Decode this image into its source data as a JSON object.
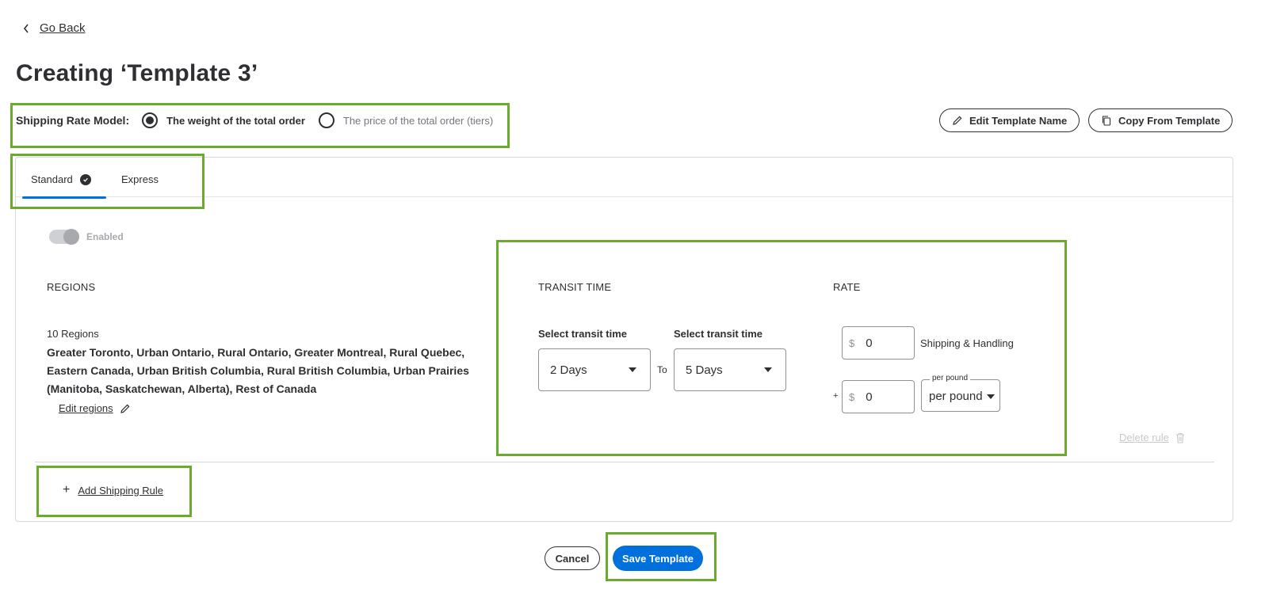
{
  "nav": {
    "go_back": "Go Back"
  },
  "page": {
    "title": "Creating ‘Template 3’"
  },
  "shipping_rate_model": {
    "label": "Shipping Rate Model:",
    "options": [
      {
        "label": "The weight of the total order",
        "selected": true
      },
      {
        "label": "The price of the total order (tiers)",
        "selected": false
      }
    ]
  },
  "actions": {
    "edit_template_name": "Edit Template Name",
    "copy_from_template": "Copy From Template"
  },
  "tabs": [
    {
      "label": "Standard",
      "active": true,
      "completed": true
    },
    {
      "label": "Express",
      "active": false,
      "completed": false
    }
  ],
  "rule": {
    "enabled_label": "Enabled",
    "enabled": true,
    "regions": {
      "heading": "REGIONS",
      "count": "10 Regions",
      "list": "Greater Toronto, Urban Ontario, Rural Ontario, Greater Montreal, Rural Quebec, Eastern Canada, Urban British Columbia, Rural British Columbia, Urban Prairies (Manitoba, Saskatchewan, Alberta), Rest of Canada",
      "edit_label": "Edit regions"
    },
    "transit": {
      "heading": "TRANSIT TIME",
      "from_label": "Select transit time",
      "from_value": "2 Days",
      "to_separator": "To",
      "to_label": "Select transit time",
      "to_value": "5 Days"
    },
    "rate": {
      "heading": "RATE",
      "currency": "$",
      "base_value": "0",
      "base_label": "Shipping & Handling",
      "plus": "+",
      "per_value": "0",
      "unit_legend": "per pound",
      "unit_value": "per pound"
    },
    "delete_label": "Delete rule"
  },
  "add_rule_label": "Add Shipping Rule",
  "plus_glyph": "+",
  "footer": {
    "cancel": "Cancel",
    "save": "Save Template"
  },
  "colors": {
    "primary": "#0071dc",
    "highlight": "#6aaa2e",
    "text": "#2e2f32",
    "muted": "#a8a9ad"
  }
}
